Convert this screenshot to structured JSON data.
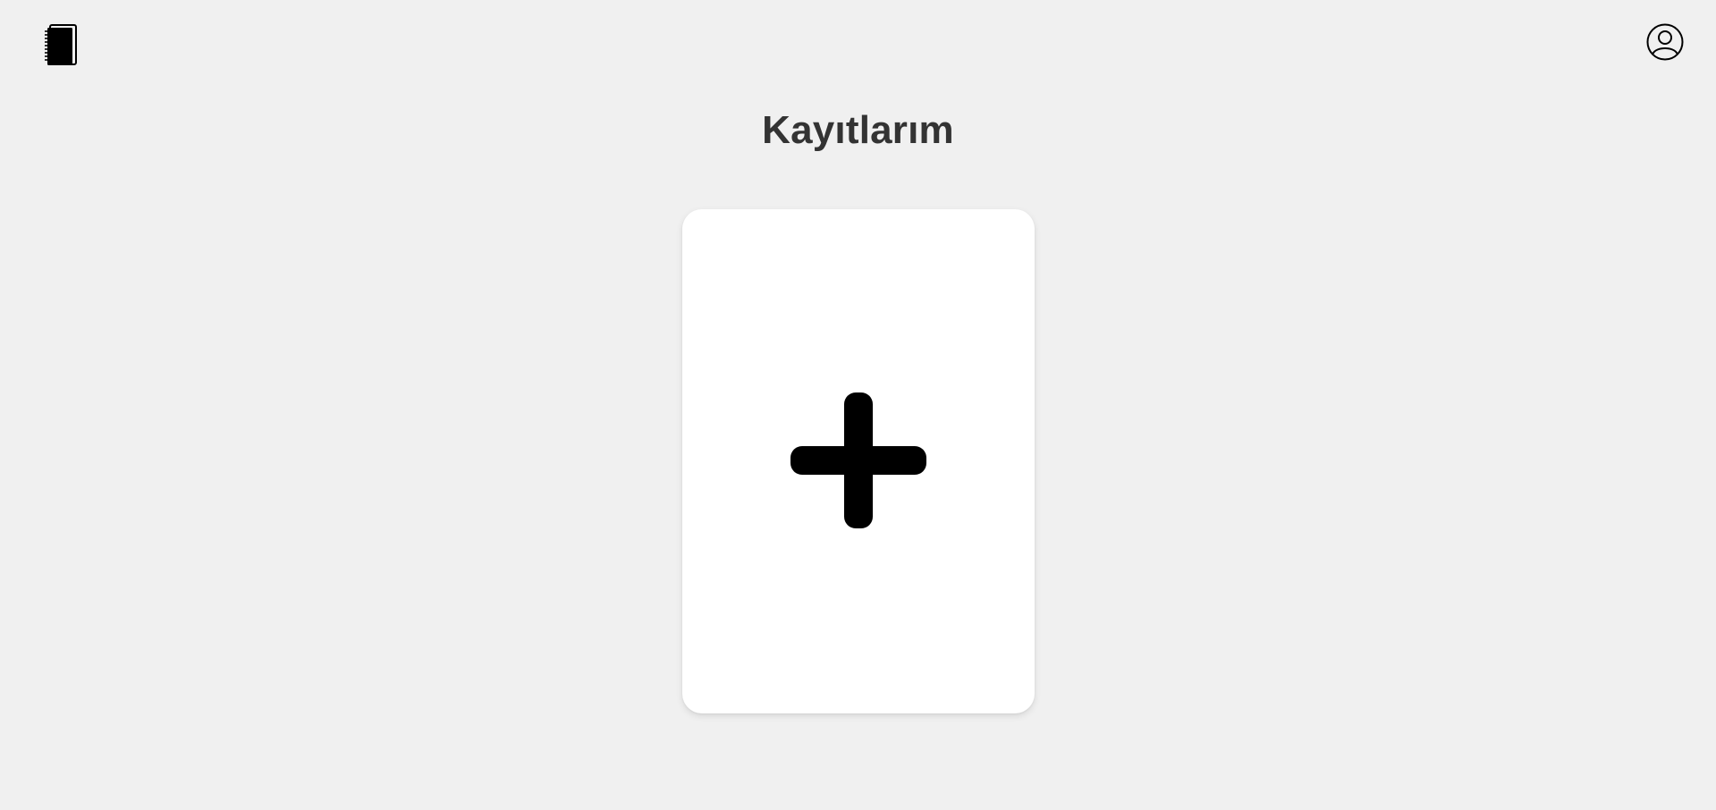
{
  "header": {
    "logo_icon": "notebook-icon",
    "profile_icon": "user-circle-icon"
  },
  "main": {
    "title": "Kayıtlarım",
    "add_card": {
      "icon": "plus-icon"
    }
  },
  "colors": {
    "background": "#f0f0f0",
    "card": "#ffffff",
    "title": "#333333",
    "icon": "#000000"
  }
}
